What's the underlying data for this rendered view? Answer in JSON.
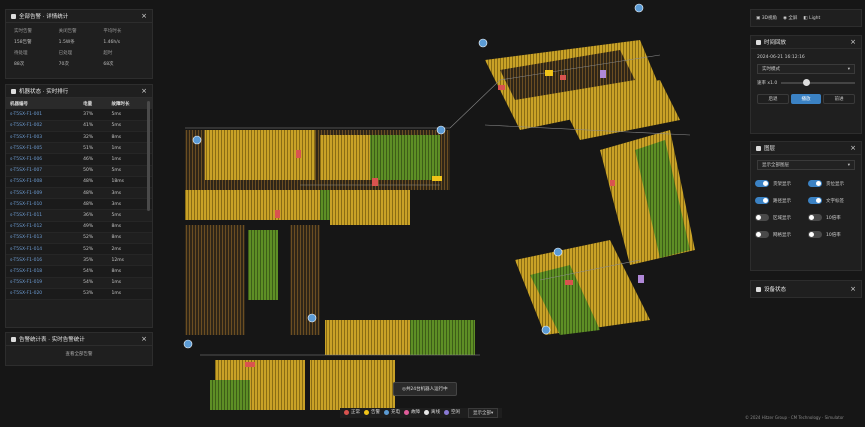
{
  "summary": {
    "title": "全部告警 · 详情统计",
    "stats": [
      {
        "label": "实时告警",
        "value": "158告警"
      },
      {
        "label": "关闭告警",
        "value": "1.5W条"
      },
      {
        "label": "平均时长",
        "value": "1.46h/s"
      },
      {
        "label": "待处理",
        "value": "88次"
      },
      {
        "label": "已处理",
        "value": "70次"
      },
      {
        "label": "超时",
        "value": "68次"
      }
    ]
  },
  "table": {
    "title": "机器状态 · 实时排行",
    "columns": [
      "机器编号",
      "电量",
      "故障时长"
    ],
    "rows": [
      [
        "s-T5SX-F1-001",
        "37%",
        "5ms"
      ],
      [
        "s-T5SX-F1-002",
        "41%",
        "5ms"
      ],
      [
        "s-T5SX-F1-003",
        "32%",
        "8ms"
      ],
      [
        "s-T5SX-F1-005",
        "51%",
        "1ms"
      ],
      [
        "s-T5SX-F1-006",
        "46%",
        "1ms"
      ],
      [
        "s-T5SX-F1-007",
        "50%",
        "5ms"
      ],
      [
        "s-T5SX-F1-008",
        "48%",
        "18ms"
      ],
      [
        "s-T5SX-F1-009",
        "48%",
        "3ms"
      ],
      [
        "s-T5SX-F1-010",
        "48%",
        "3ms"
      ],
      [
        "s-T5SX-F1-011",
        "36%",
        "5ms"
      ],
      [
        "s-T5SX-F1-012",
        "49%",
        "8ms"
      ],
      [
        "s-T5SX-F1-013",
        "52%",
        "8ms"
      ],
      [
        "s-T5SX-F1-014",
        "52%",
        "2ms"
      ],
      [
        "s-T5SX-F1-016",
        "35%",
        "12ms"
      ],
      [
        "s-T5SX-F1-018",
        "54%",
        "8ms"
      ],
      [
        "s-T5SX-F1-019",
        "54%",
        "1ms"
      ],
      [
        "s-T5SX-F1-020",
        "53%",
        "1ms"
      ]
    ]
  },
  "bottom_panel": {
    "title": "告警统计表 · 实时告警统计",
    "sub": "查看全部告警"
  },
  "topbar": {
    "items": [
      "3D视角",
      "全屏",
      "Light"
    ]
  },
  "time_panel": {
    "title": "时间回放",
    "datetime": "2024-06-21 16:12:16",
    "select": "实时模式",
    "speed_label": "速率 x1.0",
    "buttons": [
      "后退",
      "播放",
      "前进"
    ]
  },
  "layers_panel": {
    "title": "图层",
    "select": "显示全部图层",
    "toggles": [
      {
        "label": "货架显示",
        "on": true,
        "label2": "货位显示",
        "on2": true
      },
      {
        "label": "路径显示",
        "on": true,
        "label2": "文字标签",
        "on2": true
      },
      {
        "label": "区域显示",
        "on": false,
        "label2": "10倍率",
        "on2": false
      },
      {
        "label": "网格显示",
        "on": false,
        "label2": "10倍率",
        "on2": false
      }
    ]
  },
  "device_panel": {
    "title": "设备状态"
  },
  "legend": {
    "items": [
      {
        "label": "正常",
        "color": "#d9534f"
      },
      {
        "label": "告警",
        "color": "#f0c419"
      },
      {
        "label": "充电",
        "color": "#5b9bd5"
      },
      {
        "label": "故障",
        "color": "#e05c9a"
      },
      {
        "label": "离线",
        "color": "#e8e8e8"
      },
      {
        "label": "空闲",
        "color": "#8a7ad6"
      }
    ],
    "select": "显示全部"
  },
  "map_badge": "共24台机器人运行中",
  "footer": "© 2024 Hitzer Group · CM Technology · Simulator",
  "colors": {
    "shelf_yellow": "#c9a227",
    "shelf_green": "#5e8f25",
    "accent": "#3b82c4"
  },
  "map_markers": [
    "P1",
    "P2",
    "P3",
    "P4",
    "P5",
    "P6",
    "P7",
    "P8"
  ]
}
